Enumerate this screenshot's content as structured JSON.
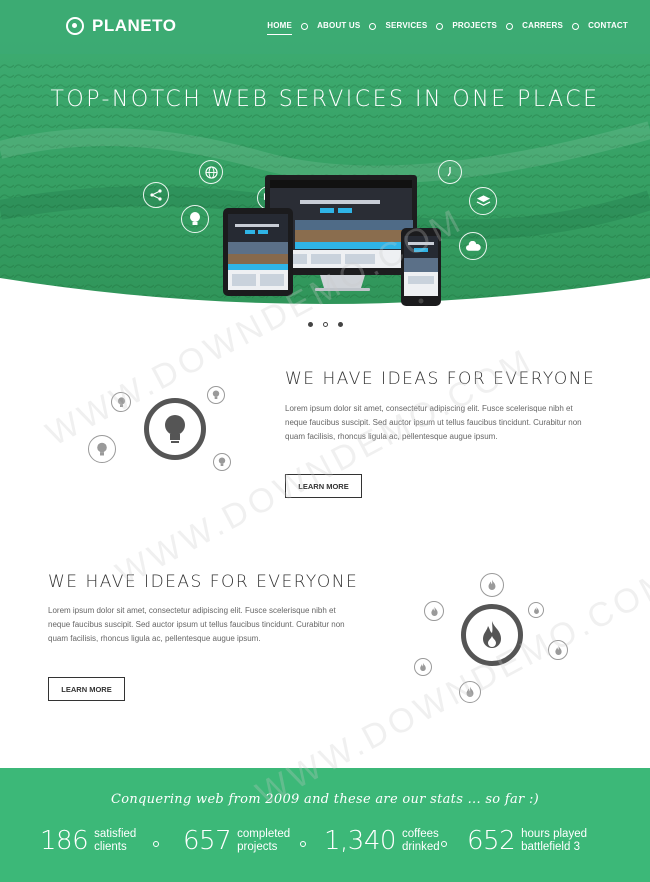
{
  "brand": {
    "name": "PLANETO"
  },
  "nav": {
    "items": [
      {
        "label": "HOME",
        "active": true
      },
      {
        "label": "ABOUT US",
        "active": false
      },
      {
        "label": "SERVICES",
        "active": false
      },
      {
        "label": "PROJECTS",
        "active": false
      },
      {
        "label": "CARRERS",
        "active": false
      },
      {
        "label": "CONTACT",
        "active": false
      }
    ]
  },
  "hero": {
    "title": "TOP-NOTCH WEB SERVICES IN ONE PLACE",
    "icons": [
      "share-icon",
      "globe-icon",
      "lightbulb-icon",
      "chat-icon",
      "clock-icon",
      "layers-icon",
      "cloud-icon"
    ],
    "slider": {
      "count": 3,
      "active_index": 1
    }
  },
  "features": [
    {
      "title": "WE HAVE IDEAS FOR EVERYONE",
      "text": "Lorem ipsum dolor sit amet, consectetur adipiscing elit. Fusce scelerisque nibh et neque faucibus suscipit. Sed auctor ipsum ut tellus faucibus tincidunt. Curabitur non quam facilisis, rhoncus ligula ac, pellentesque augue ipsum.",
      "button": "LEARN MORE",
      "icon": "lightbulb-icon"
    },
    {
      "title": "WE HAVE IDEAS FOR EVERYONE",
      "text": "Lorem ipsum dolor sit amet, consectetur adipiscing elit. Fusce scelerisque nibh et neque faucibus suscipit. Sed auctor ipsum ut tellus faucibus tincidunt. Curabitur non quam facilisis, rhoncus ligula ac, pellentesque augue ipsum.",
      "button": "LEARN MORE",
      "icon": "fire-icon"
    }
  ],
  "stats": {
    "tagline": "Conquering web from 2009 and these are our stats ... so far :)",
    "items": [
      {
        "number": "186",
        "label_line1": "satisfied",
        "label_line2": "clients"
      },
      {
        "number": "657",
        "label_line1": "completed",
        "label_line2": "projects"
      },
      {
        "number": "1,340",
        "label_line1": "coffees",
        "label_line2": "drinked"
      },
      {
        "number": "652",
        "label_line1": "hours played",
        "label_line2": "battlefield 3"
      }
    ]
  },
  "watermark": "WWW.DOWNDEMO.COM",
  "colors": {
    "brand_green": "#3cb878",
    "dark_text": "#333333",
    "body_text": "#666666"
  }
}
